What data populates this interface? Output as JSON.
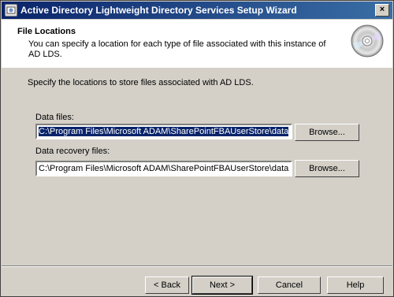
{
  "window": {
    "title": "Active Directory Lightweight Directory Services Setup Wizard",
    "close_label": "×"
  },
  "header": {
    "title": "File Locations",
    "subtitle": "You can specify a location for each type of file associated with this instance of AD LDS."
  },
  "main": {
    "intro": "Specify the locations to store files associated with AD LDS.",
    "data_files": {
      "label": "Data files:",
      "value": "C:\\Program Files\\Microsoft ADAM\\SharePointFBAUserStore\\data",
      "browse_label": "Browse..."
    },
    "recovery_files": {
      "label": "Data recovery files:",
      "value": "C:\\Program Files\\Microsoft ADAM\\SharePointFBAUserStore\\data",
      "browse_label": "Browse..."
    }
  },
  "footer": {
    "back_label": "< Back",
    "next_label": "Next >",
    "cancel_label": "Cancel",
    "help_label": "Help"
  },
  "colors": {
    "titlebar_start": "#0a246a",
    "titlebar_end": "#3a6ea5",
    "dialog_bg": "#d4d0c8",
    "selection": "#0a246a"
  }
}
